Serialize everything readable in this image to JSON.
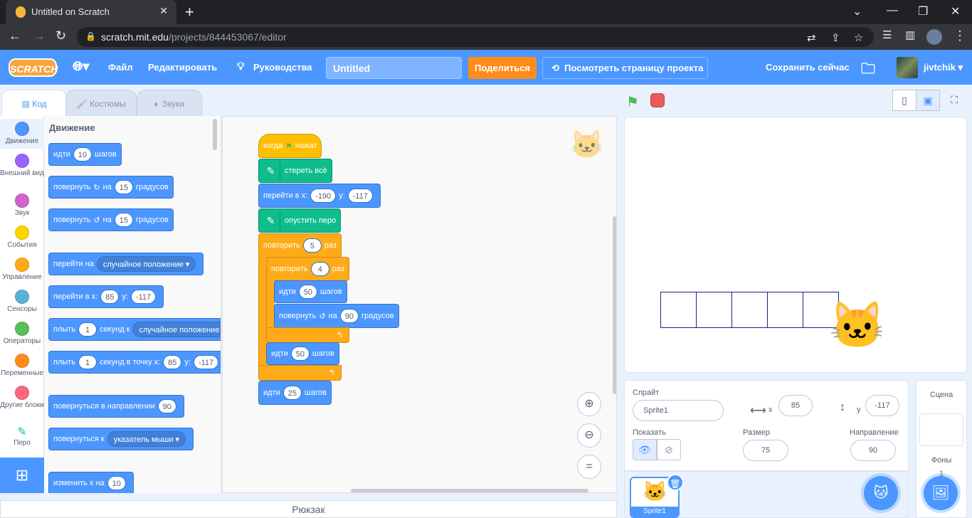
{
  "browser": {
    "tab_title": "Untitled on Scratch",
    "url_host": "scratch.mit.edu",
    "url_path": "/projects/844453067/editor"
  },
  "menubar": {
    "logo": "SCRATCH",
    "file": "Файл",
    "edit": "Редактировать",
    "tutorials": "Руководства",
    "project_title": "Untitled",
    "share": "Поделиться",
    "see_project_page": "Посмотреть страницу проекта",
    "save_now": "Сохранить сейчас",
    "username": "jivtchik"
  },
  "editor_tabs": {
    "code": "Код",
    "costumes": "Костюмы",
    "sounds": "Звуки"
  },
  "categories": [
    {
      "label": "Движение",
      "color": "#4c97ff"
    },
    {
      "label": "Внешний вид",
      "color": "#9966ff"
    },
    {
      "label": "Звук",
      "color": "#cf63cf"
    },
    {
      "label": "События",
      "color": "#ffd500"
    },
    {
      "label": "Управление",
      "color": "#ffab19"
    },
    {
      "label": "Сенсоры",
      "color": "#5cb1d6"
    },
    {
      "label": "Операторы",
      "color": "#59c059"
    },
    {
      "label": "Переменные",
      "color": "#ff8c1a"
    },
    {
      "label": "Другие блоки",
      "color": "#ff6680"
    },
    {
      "label": "Перо",
      "color": "#0fbd8c"
    }
  ],
  "palette": {
    "section": "Движение",
    "move_steps": {
      "a": "идти",
      "v": "10",
      "b": "шагов"
    },
    "turn_right": {
      "a": "повернуть",
      "b": "на",
      "v": "15",
      "c": "градусов"
    },
    "turn_left": {
      "a": "повернуть",
      "b": "на",
      "v": "15",
      "c": "градусов"
    },
    "goto": {
      "a": "перейти на",
      "d": "случайное положение"
    },
    "goto_xy": {
      "a": "перейти в x:",
      "x": "85",
      "b": "y:",
      "y": "-117"
    },
    "glide": {
      "a": "плыть",
      "v": "1",
      "b": "секунд к",
      "d": "случайное положение"
    },
    "glide_xy": {
      "a": "плыть",
      "v": "1",
      "b": "секунд в точку x:",
      "x": "85",
      "c": "y:",
      "y": "-117"
    },
    "point_dir": {
      "a": "повернуться в направлении",
      "v": "90"
    },
    "point_towards": {
      "a": "повернуться к",
      "d": "указатель мыши"
    },
    "change_x": {
      "a": "изменить x на",
      "v": "10"
    }
  },
  "script": {
    "when_flag": {
      "a": "когда",
      "b": "нажат"
    },
    "clear": "стереть всё",
    "goto_xy": {
      "a": "перейти в x:",
      "x": "-190",
      "b": "у:",
      "y": "-117"
    },
    "pen_down": "опустить перо",
    "repeat_outer": {
      "a": "повторить",
      "v": "5",
      "b": "раз"
    },
    "repeat_inner": {
      "a": "повторить",
      "v": "4",
      "b": "раз"
    },
    "move1": {
      "a": "идти",
      "v": "50",
      "b": "шагов"
    },
    "turn": {
      "a": "повернуть",
      "b": "на",
      "v": "90",
      "c": "градусов"
    },
    "move2": {
      "a": "идти",
      "v": "50",
      "b": "шагов"
    },
    "move3": {
      "a": "идти",
      "v": "25",
      "b": "шагов"
    }
  },
  "backpack": "Рюкзак",
  "sprite_info": {
    "sprite_label": "Спрайт",
    "sprite_name": "Sprite1",
    "x_label": "x",
    "x": "85",
    "y_label": "y",
    "y": "-117",
    "show_label": "Показать",
    "size_label": "Размер",
    "size": "75",
    "direction_label": "Направление",
    "direction": "90"
  },
  "sprite_list": {
    "sprite_name": "Sprite1"
  },
  "stage_target": {
    "title": "Сцена",
    "backdrops_label": "Фоны",
    "backdrops_count": "1"
  }
}
